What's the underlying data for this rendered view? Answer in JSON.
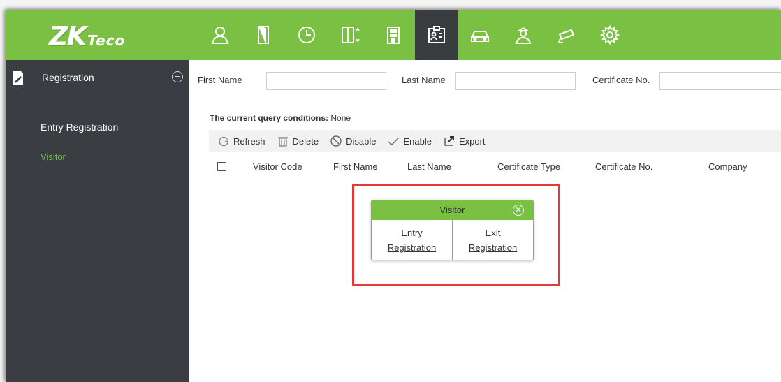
{
  "brand": {
    "logo_main": "ZK",
    "logo_sub": "Teco"
  },
  "colors": {
    "accent": "#7ac143",
    "sidebar": "#3a3e42",
    "highlight": "#e53935"
  },
  "nav": {
    "icons": [
      "person-icon",
      "door-icon",
      "clock-icon",
      "elevator-icon",
      "building-icon",
      "visitor-card-icon",
      "car-icon",
      "guard-icon",
      "camera-icon",
      "gear-icon"
    ],
    "active_index": 5
  },
  "sidebar": {
    "section_title": "Registration",
    "items": [
      {
        "label": "Entry Registration"
      },
      {
        "label": "Visitor"
      }
    ]
  },
  "filters": {
    "first_name_label": "First Name",
    "first_name_value": "",
    "last_name_label": "Last Name",
    "last_name_value": "",
    "certificate_label": "Certificate No.",
    "certificate_value": ""
  },
  "query": {
    "prefix": "The current query conditions:",
    "value": "None"
  },
  "toolbar": {
    "refresh": "Refresh",
    "delete": "Delete",
    "disable": "Disable",
    "enable": "Enable",
    "export": "Export"
  },
  "table": {
    "columns": [
      "Visitor Code",
      "First Name",
      "Last Name",
      "Certificate Type",
      "Certificate No.",
      "Company"
    ]
  },
  "popup": {
    "title": "Visitor",
    "entry_line1": "Entry",
    "entry_line2": "Registration",
    "exit_line1": "Exit",
    "exit_line2": "Registration"
  }
}
